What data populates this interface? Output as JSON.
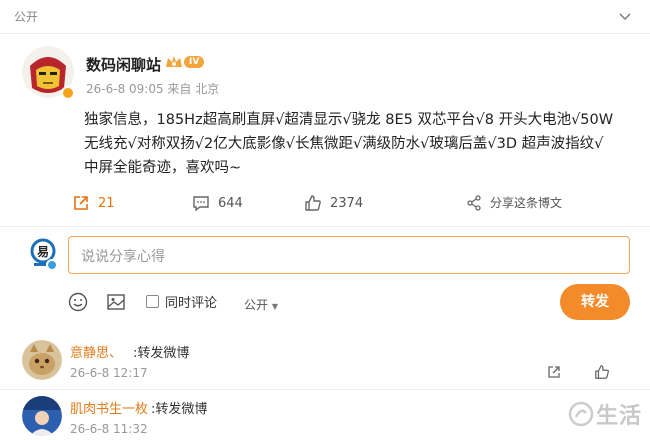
{
  "topbar": {
    "visibility_label": "公开"
  },
  "post": {
    "username": "数码闲聊站",
    "vip_level": "IV",
    "meta": "26-6-8 09:05  来自 北京",
    "content_line1": "独家信息，185Hz超高刷直屏√超清显示√骁龙 8E5 双芯平台√8 开头大电池√50W",
    "content_line2": "无线充√对称双扬√2亿大底影像√长焦微距√满级防水√玻璃后盖√3D 超声波指纹√",
    "content_line3": "中屏全能奇迹，喜欢吗~",
    "actions": {
      "repost_count": "21",
      "comment_count": "644",
      "like_count": "2374",
      "share_label": "分享这条博文"
    }
  },
  "composer": {
    "placeholder": "说说分享心得",
    "also_comment_label": "同时评论",
    "visibility_label": "公开",
    "submit_label": "转发"
  },
  "reposts": [
    {
      "name": "意静思、",
      "text": ":转发微博",
      "time": "26-6-8 12:17"
    },
    {
      "name": "肌肉书生一枚",
      "text": ":转发微博",
      "time": "26-6-8 11:32"
    }
  ],
  "colors": {
    "accent": "#f38b2b",
    "link": "#e07b1a",
    "verified": "#3d9bdf"
  }
}
